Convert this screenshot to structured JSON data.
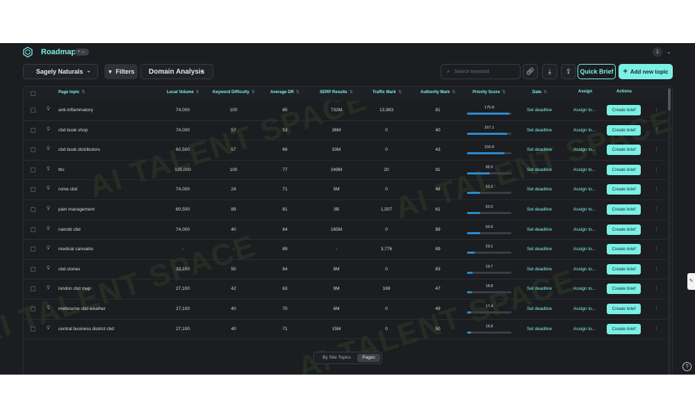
{
  "app": {
    "title": "Roadmap",
    "badge": "• ⌄",
    "watermark": "AI TALENT SPACE"
  },
  "toolbar": {
    "site": "Sagely Naturals",
    "filters": "Filters",
    "domain_analysis": "Domain Analysis",
    "search_placeholder": "Search keyword",
    "quick_brief": "Quick Brief",
    "add_topic": "Add new topic"
  },
  "table": {
    "headers": [
      "Page topic",
      "Local Volume",
      "Keyword Difficulty",
      "Average DR",
      "SERP Results",
      "Traffic Mark",
      "Authority Mark",
      "Priority Score",
      "Date",
      "Assign",
      "Actions"
    ],
    "set_deadline": "Set deadline",
    "assign_to": "Assign to...",
    "create_brief": "Create brief",
    "rows": [
      {
        "topic": "anti-inflammatory",
        "volume": "74,000",
        "kd": "100",
        "dr": "85",
        "serp": "732M",
        "traffic": "13,983",
        "authority": "81",
        "priority": "175.8",
        "fill": 0.95
      },
      {
        "topic": "cbd book shop",
        "volume": "74,000",
        "kd": "57",
        "dr": "53",
        "serp": "36M",
        "traffic": "0",
        "authority": "40",
        "priority": "167.1",
        "fill": 0.9
      },
      {
        "topic": "cbd book distributors",
        "volume": "60,500",
        "kd": "57",
        "dr": "66",
        "serp": "33M",
        "traffic": "0",
        "authority": "43",
        "priority": "156.8",
        "fill": 0.85
      },
      {
        "topic": "thc",
        "volume": "135,000",
        "kd": "100",
        "dr": "77",
        "serp": "249M",
        "traffic": "20",
        "authority": "91",
        "priority": "95.5",
        "fill": 0.52
      },
      {
        "topic": "rome cbd",
        "volume": "74,000",
        "kd": "24",
        "dr": "71",
        "serp": "5M",
        "traffic": "0",
        "authority": "48",
        "priority": "52.1",
        "fill": 0.3
      },
      {
        "topic": "pain management",
        "volume": "60,500",
        "kd": "89",
        "dr": "81",
        "serp": "3B",
        "traffic": "1,507",
        "authority": "61",
        "priority": "52.0",
        "fill": 0.3
      },
      {
        "topic": "nairobi cbd",
        "volume": "74,000",
        "kd": "40",
        "dr": "84",
        "serp": "165M",
        "traffic": "0",
        "authority": "89",
        "priority": "50.9",
        "fill": 0.29
      },
      {
        "topic": "medical cannabis",
        "volume": "-",
        "kd": "-",
        "dr": "89",
        "serp": "-",
        "traffic": "3,776",
        "authority": "89",
        "priority": "29.1",
        "fill": 0.17
      },
      {
        "topic": "cbd stones",
        "volume": "33,100",
        "kd": "50",
        "dr": "84",
        "serp": "8M",
        "traffic": "0",
        "authority": "83",
        "priority": "19.7",
        "fill": 0.12
      },
      {
        "topic": "london cbd map",
        "volume": "27,100",
        "kd": "42",
        "dr": "63",
        "serp": "9M",
        "traffic": "169",
        "authority": "47",
        "priority": "18.8",
        "fill": 0.11
      },
      {
        "topic": "melbourne cbd weather",
        "volume": "27,100",
        "kd": "40",
        "dr": "70",
        "serp": "6M",
        "traffic": "0",
        "authority": "49",
        "priority": "17.4",
        "fill": 0.1
      },
      {
        "topic": "central business district cbd",
        "volume": "27,100",
        "kd": "40",
        "dr": "71",
        "serp": "15M",
        "traffic": "0",
        "authority": "50",
        "priority": "16.8",
        "fill": 0.1
      }
    ]
  },
  "view_toggle": {
    "site_topics": "By Site Topics",
    "pages": "Pages"
  },
  "colors": {
    "accent": "#7cf0e5",
    "background": "#1b1d21",
    "priority_bar": "#2d8bd0"
  },
  "icons": {
    "logo": "hexagon-logo-icon",
    "filter": "filter-icon",
    "search": "search-icon",
    "link": "link-icon",
    "download": "download-icon",
    "share": "share-icon",
    "bulb": "lightbulb-icon",
    "help": "help-icon"
  }
}
